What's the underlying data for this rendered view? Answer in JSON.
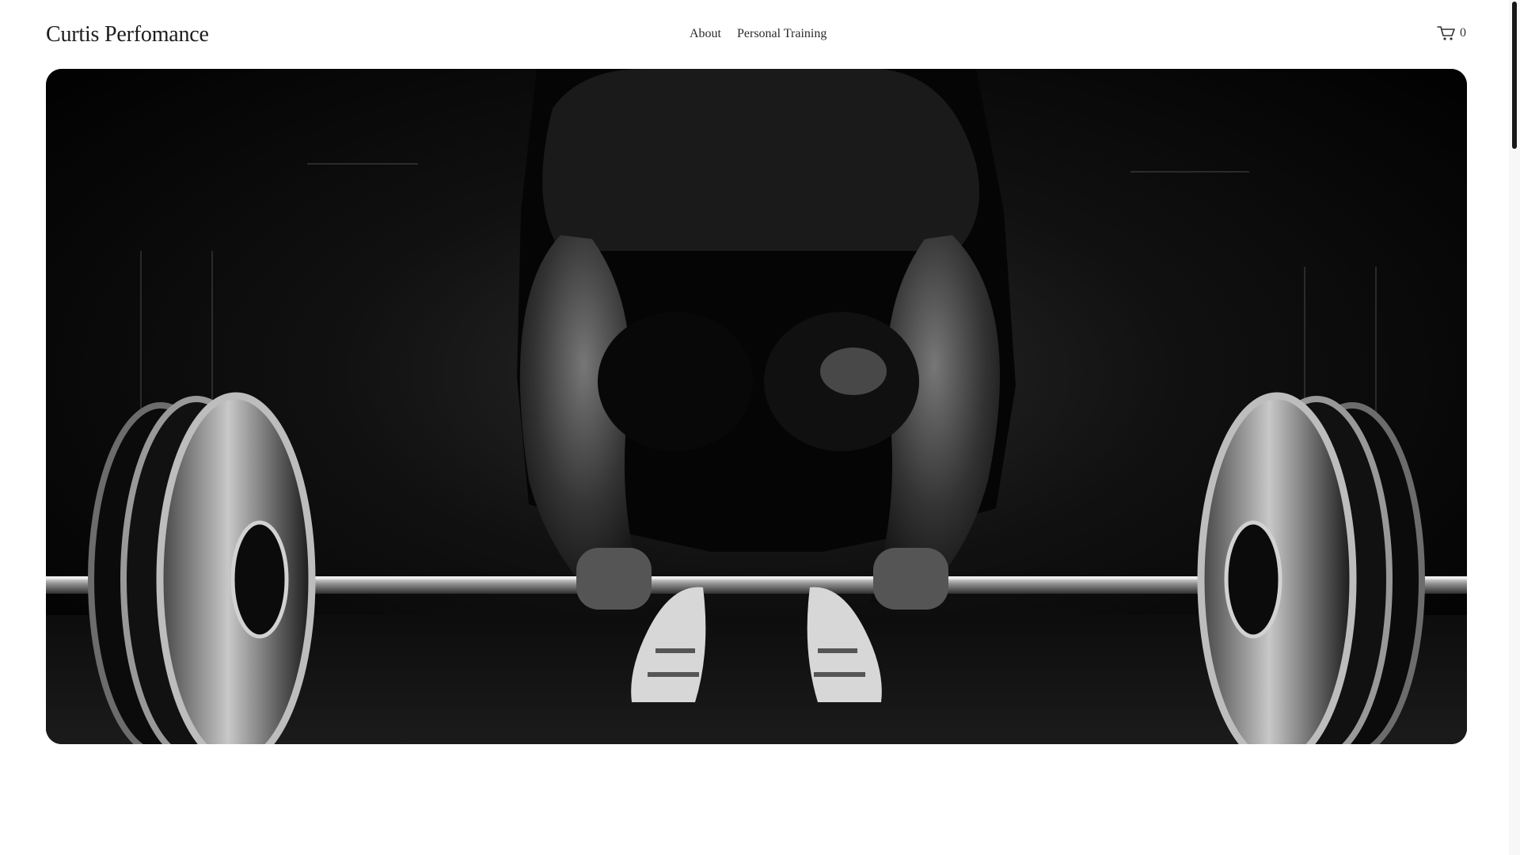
{
  "brand": {
    "name": "Curtis Perfomance"
  },
  "nav": {
    "items": [
      {
        "label": "About"
      },
      {
        "label": "Personal Training"
      }
    ]
  },
  "cart": {
    "icon": "shopping-cart-icon",
    "count": "0"
  },
  "hero": {
    "image_subject": "black-and-white photo of an athlete gripping a loaded barbell for a deadlift"
  },
  "colors": {
    "background": "#ffffff",
    "text": "#1d1d1d",
    "hero_dark": "#050505",
    "scroll_thumb": "#161616"
  }
}
